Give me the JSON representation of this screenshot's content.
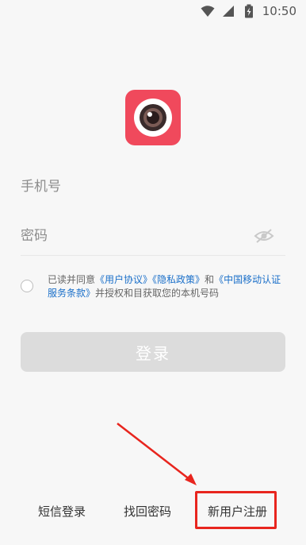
{
  "status_bar": {
    "time": "10:50",
    "icons": [
      "wifi-icon",
      "cellular-signal-icon",
      "battery-charging-icon"
    ]
  },
  "app": {
    "logo_icon": "camera-lens-icon",
    "brand_color": "#f0495c"
  },
  "form": {
    "phone_placeholder": "手机号",
    "password_placeholder": "密码",
    "password_toggle_icon": "eye-off-icon"
  },
  "agreement": {
    "text_prefix": "已读并同意",
    "user_agreement": "《用户协议》",
    "privacy_policy": "《隐私政策》",
    "conjunction": "和",
    "cmcc_terms": "《中国移动认证服务条款》",
    "text_suffix": "并授权和目获取您的本机号码",
    "link_color": "#1a6fc9"
  },
  "login_button": {
    "label": "登录",
    "bg_color": "#dcdcdc"
  },
  "bottom_links": {
    "sms_login": "短信登录",
    "recover_password": "找回密码",
    "register": "新用户注册"
  },
  "annotation": {
    "highlight_color": "#e8251e",
    "target": "新用户注册"
  }
}
